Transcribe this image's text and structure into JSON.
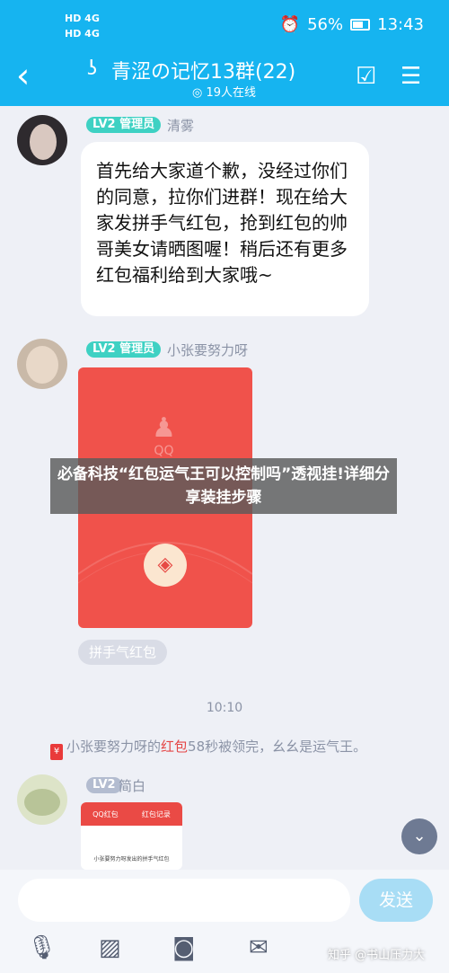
{
  "status_bar": {
    "signal_1": "HD 4G",
    "signal_2": "HD 4G",
    "battery": "56%",
    "time": "13:43"
  },
  "header": {
    "title": "青涩の记忆13群(22)",
    "members_online": "19人在线"
  },
  "messages": [
    {
      "level": "LV2",
      "role": "管理员",
      "sender": "清雾",
      "text": "首先给大家道个歉，没经过你们的同意，拉你们进群！现在给大家发拼手气红包，抢到红包的帅哥美女请晒图喔！稍后还有更多红包福利给到大家哦~"
    },
    {
      "level": "LV2",
      "role": "管理员",
      "sender": "小张要努力呀",
      "packet_logo": "QQ",
      "packet_label": "拼手气红包"
    },
    {
      "level": "LV2",
      "sender": "简白",
      "card_tabs": [
        "QQ红包",
        "红包记录"
      ],
      "card_caption": "小张要努力呀发出的拼手气红包"
    }
  ],
  "overlay_text": "必备科技“红包运气王可以控制吗”透视挂!详细分享装挂步骤",
  "time_label": "10:10",
  "system_message": {
    "name": "小张要努力呀的",
    "link": "红包",
    "rest": "58秒被领完，幺幺是运气王。"
  },
  "input": {
    "placeholder": "",
    "send_label": "发送"
  },
  "watermark": "知乎 @书山压力大",
  "colors": {
    "header": "#16b4f0",
    "badge": "#3ed1c3",
    "red_packet": "#f0524b",
    "link": "#e54545"
  }
}
